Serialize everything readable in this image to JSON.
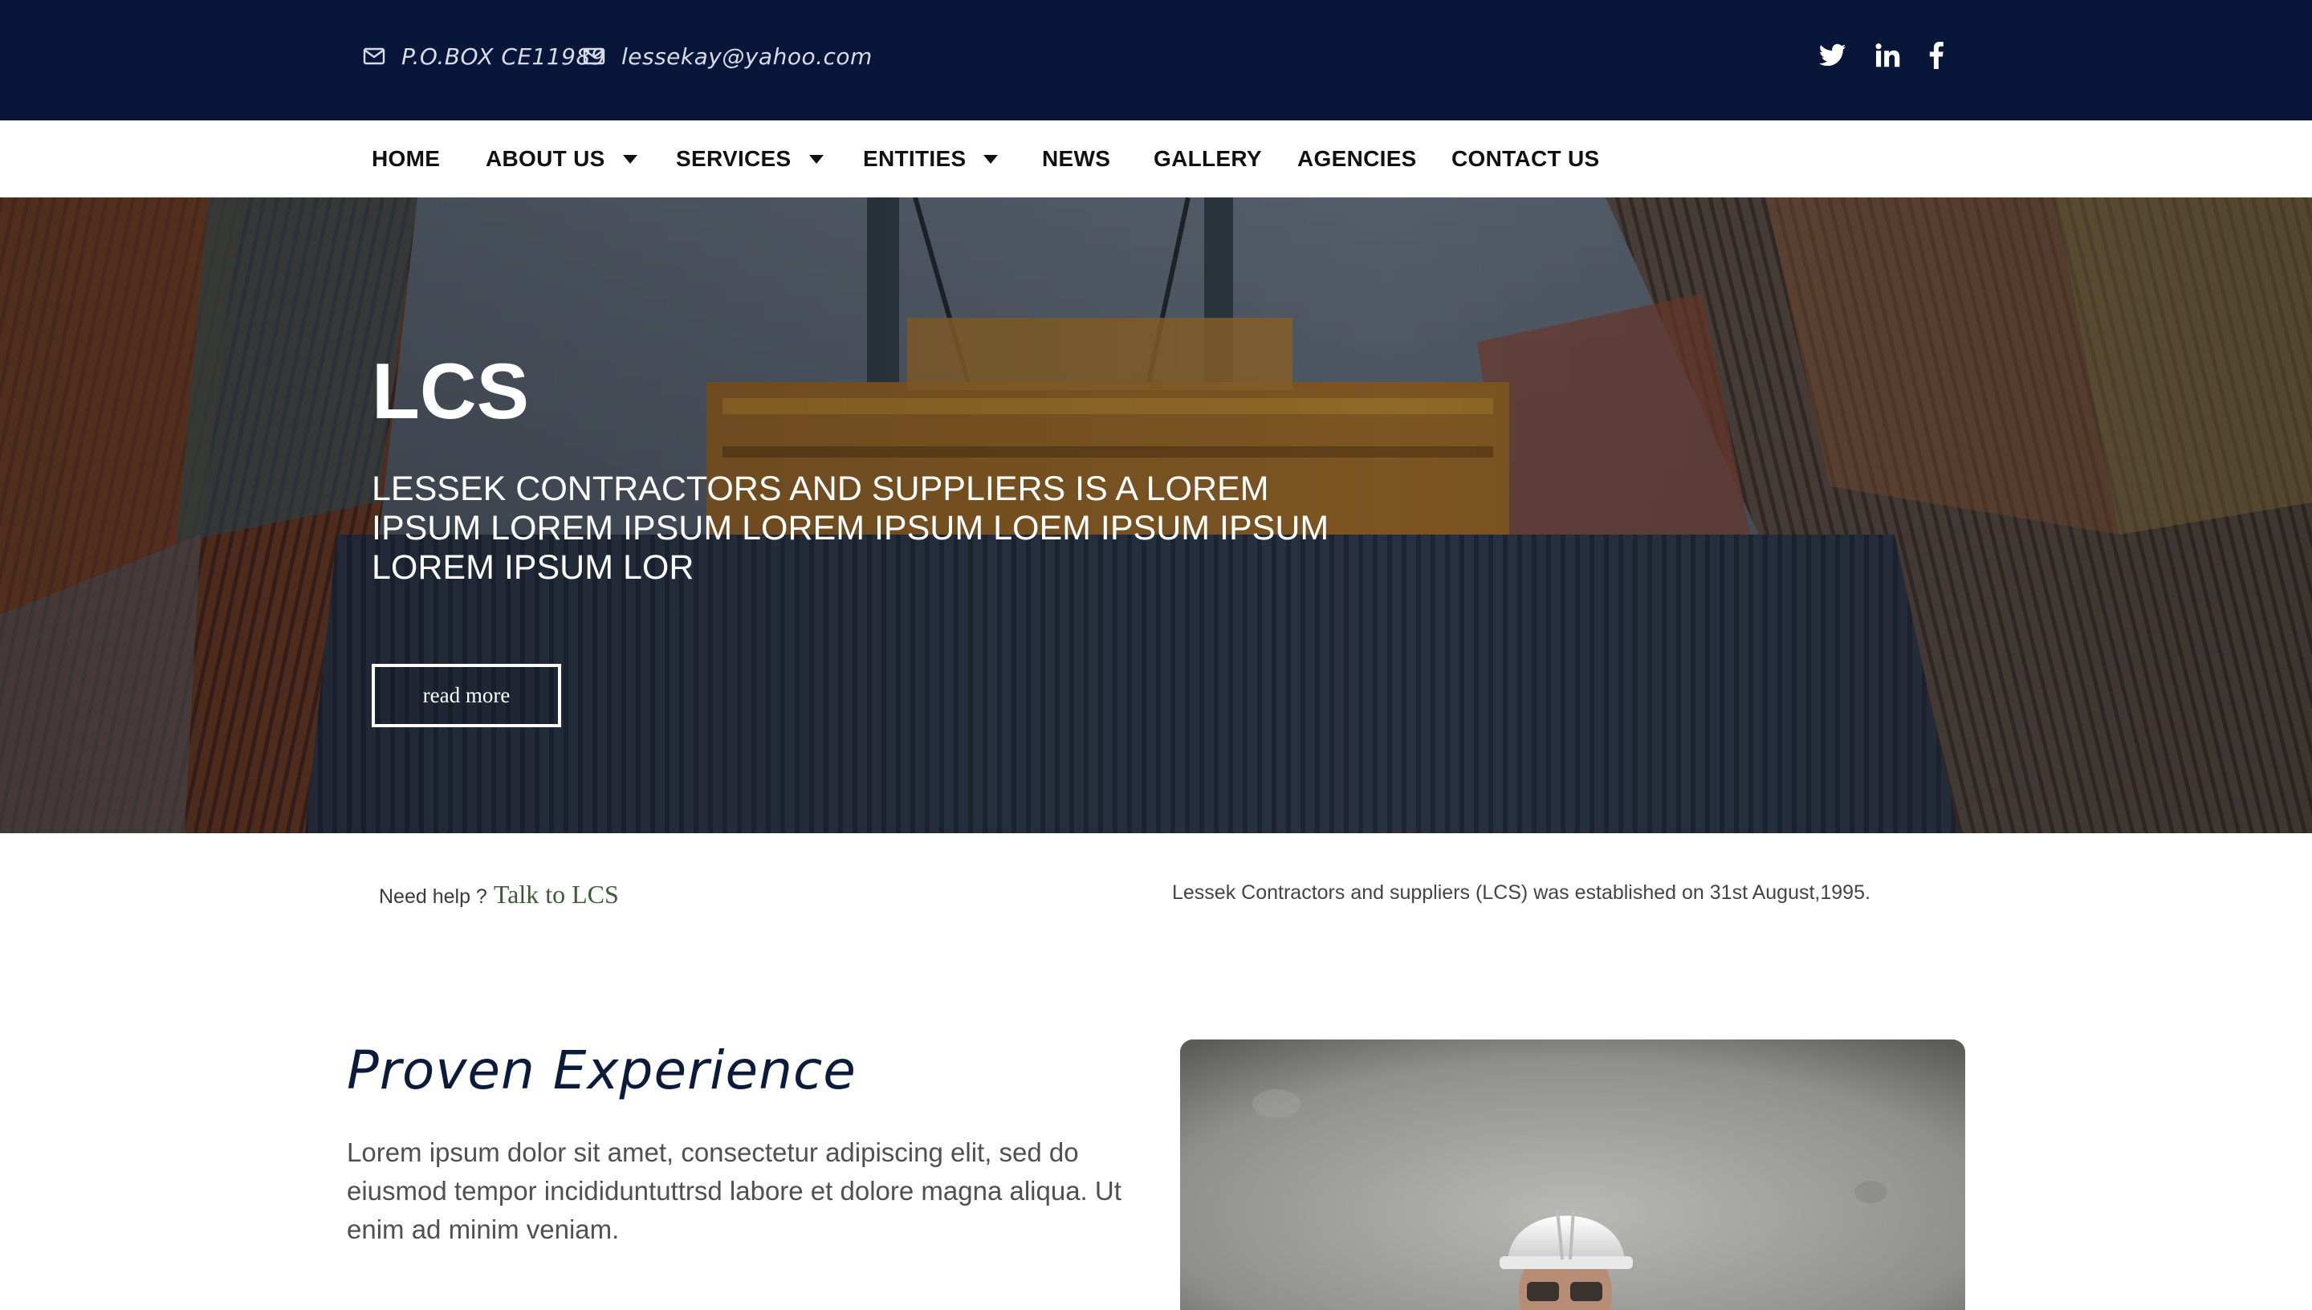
{
  "topbar": {
    "pobox": "P.O.BOX CE11989",
    "email": "lessekay@yahoo.com",
    "social_icons": [
      "twitter-icon",
      "linkedin-icon",
      "facebook-icon"
    ],
    "background_color": "#08163a"
  },
  "nav": {
    "items": [
      {
        "label": "HOME",
        "has_dropdown": false
      },
      {
        "label": "ABOUT US",
        "has_dropdown": true
      },
      {
        "label": "SERVICES",
        "has_dropdown": true
      },
      {
        "label": "ENTITIES",
        "has_dropdown": true
      },
      {
        "label": "NEWS",
        "has_dropdown": false
      },
      {
        "label": "GALLERY",
        "has_dropdown": false
      },
      {
        "label": "AGENCIES",
        "has_dropdown": false
      },
      {
        "label": "CONTACT US",
        "has_dropdown": false
      }
    ]
  },
  "hero": {
    "title": "LCS",
    "subtitle": "LESSEK CONTRACTORS AND SUPPLIERS IS A LOREM IPSUM LOREM IPSUM LOREM IPSUM LOEM IPSUM IPSUM LOREM IPSUM LOR",
    "button_label": "read more"
  },
  "info": {
    "help_label": "Need help ?",
    "help_link": "Talk to LCS",
    "established": "Lessek Contractors and suppliers (LCS) was established on 31st August,1995."
  },
  "section": {
    "title": "Proven Experience",
    "body": "Lorem ipsum dolor sit amet, consectetur adipiscing elit, sed do eiusmod tempor incididuntuttrsd labore et dolore magna aliqua. Ut enim ad minim veniam."
  }
}
